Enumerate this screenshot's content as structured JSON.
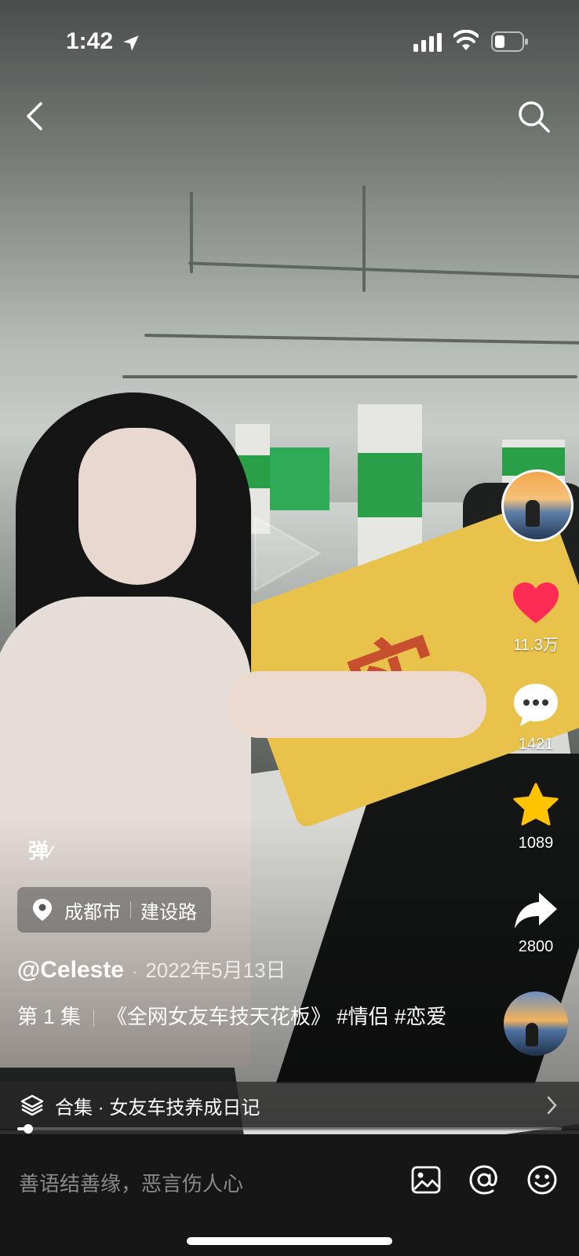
{
  "status_bar": {
    "time": "1:42"
  },
  "location": {
    "city": "成都市",
    "road": "建设路"
  },
  "danmu_label": "弹",
  "author": {
    "handle": "@Celeste",
    "date": "2022年5月13日"
  },
  "caption": {
    "episode": "第 1 集",
    "text": "《全网女友车技天花板》 #情侣 #恋爱"
  },
  "collection": {
    "label": "合集 · 女友车技养成日记"
  },
  "actions": {
    "likes": "11.3万",
    "comments": "1421",
    "favorites": "1089",
    "shares": "2800"
  },
  "progress": {
    "fraction": 0.02
  },
  "comment_input": {
    "placeholder": "善语结善缘，恶言伤人心"
  },
  "colors": {
    "like": "#fe2c55",
    "favorite": "#ffc300",
    "background_bar": "#161616"
  },
  "icons": [
    "location-arrow-icon",
    "signal-icon",
    "wifi-icon",
    "battery-icon",
    "back-icon",
    "search-icon",
    "heart-icon",
    "comment-icon",
    "star-icon",
    "share-icon",
    "pin-icon",
    "layers-icon",
    "chevron-right-icon",
    "image-icon",
    "at-icon",
    "emoji-icon"
  ]
}
